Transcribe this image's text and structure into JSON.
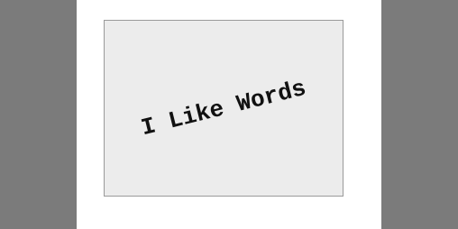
{
  "card": {
    "text": "I Like Words"
  },
  "colors": {
    "backdrop": "#7b7b7b",
    "paper": "#ffffff",
    "card_fill": "#ececec",
    "card_border": "#9a9a9a",
    "text": "#111111"
  }
}
